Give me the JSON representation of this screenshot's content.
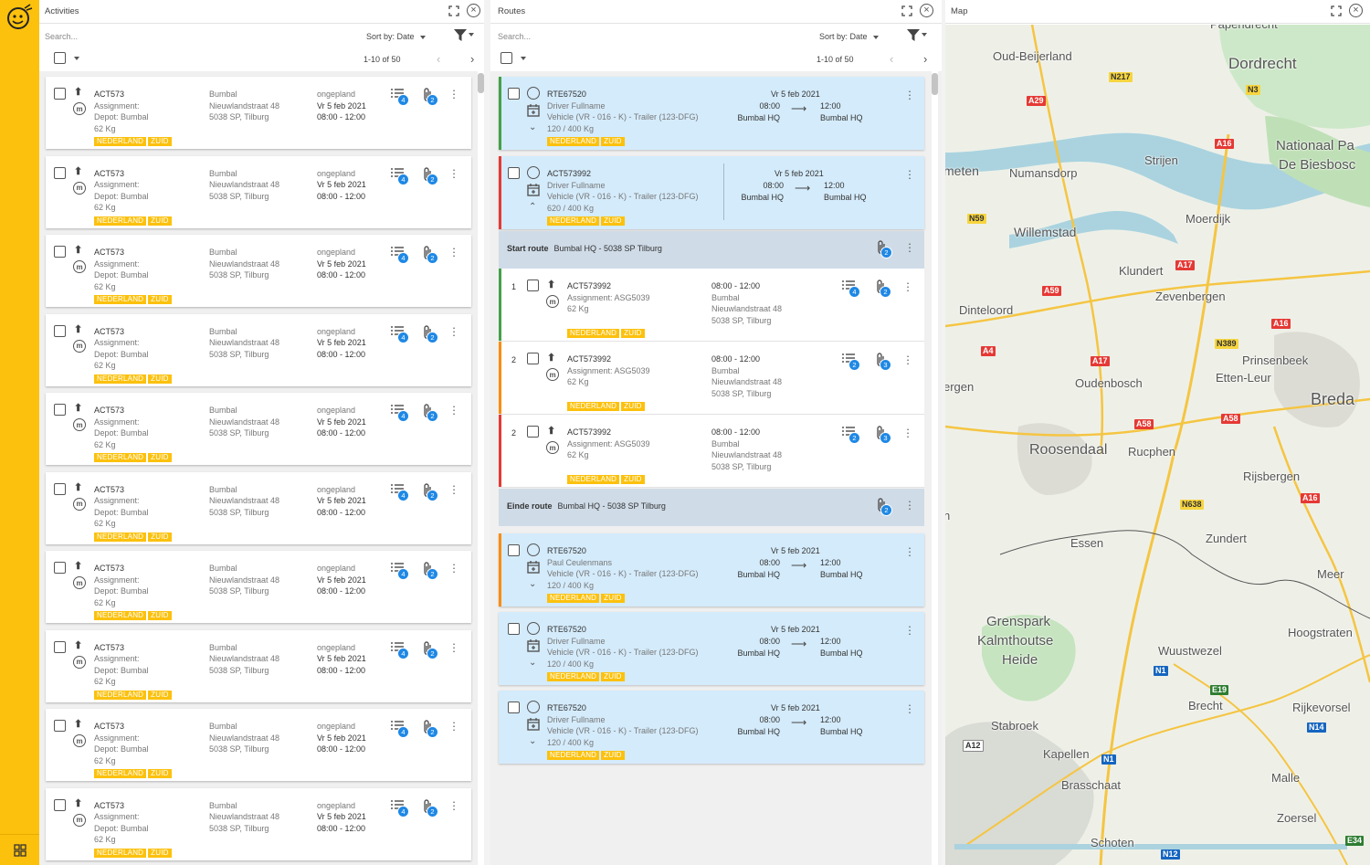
{
  "panels": {
    "activities": {
      "title": "Activities",
      "search_placeholder": "Search...",
      "sort_label": "Sort by: Date",
      "pager": "1-10 of 50"
    },
    "routes": {
      "title": "Routes",
      "search_placeholder": "Search...",
      "sort_label": "Sort by: Date",
      "pager": "1-10 of 50"
    },
    "map": {
      "title": "Map"
    }
  },
  "colors": {
    "brand": "#fcc10d",
    "badge": "#1e88e5",
    "route_bg": "#d4ebfb",
    "green": "#43a047",
    "red": "#e53935",
    "orange": "#fb8c00"
  },
  "activity_template": {
    "id": "ACT573",
    "assignment": "Assignment:",
    "depot": "Depot: Bumbal",
    "weight": "62 Kg",
    "addr_name": "Bumbal",
    "addr_street": "Nieuwlandstraat 48",
    "addr_city": "5038 SP, Tilburg",
    "status": "ongepland",
    "date": "Vr 5 feb 2021",
    "time": "08:00 - 12:00",
    "tags": [
      "NEDERLAND",
      "ZUID"
    ],
    "list_count": "4",
    "clip_count": "2"
  },
  "activity_count": 10,
  "routes": [
    {
      "id": "RTE67520",
      "driver": "Driver Fullname",
      "vehicle": "Vehicle (VR - 016 - K) - Trailer (123-DFG)",
      "load": "120 / 400 Kg",
      "date": "Vr 5 feb 2021",
      "start_time": "08:00",
      "start_place": "Bumbal HQ",
      "end_time": "12:00",
      "end_place": "Bumbal HQ",
      "tags": [
        "NEDERLAND",
        "ZUID"
      ],
      "bar": "#43a047"
    },
    {
      "id": "ACT573992",
      "driver": "Driver Fullname",
      "vehicle": "Vehicle (VR - 016 - K) - Trailer (123-DFG)",
      "load": "620 / 400 Kg",
      "date": "Vr 5 feb 2021",
      "start_time": "08:00",
      "start_place": "Bumbal HQ",
      "end_time": "12:00",
      "end_place": "Bumbal HQ",
      "tags": [
        "NEDERLAND",
        "ZUID"
      ],
      "bar": "#e53935"
    },
    {
      "id": "RTE67520",
      "driver": "Paul Ceulenmans",
      "vehicle": "Vehicle (VR - 016 - K) - Trailer (123-DFG)",
      "load": "120 / 400 Kg",
      "date": "Vr 5 feb 2021",
      "start_time": "08:00",
      "start_place": "Bumbal HQ",
      "end_time": "12:00",
      "end_place": "Bumbal HQ",
      "tags": [
        "NEDERLAND",
        "ZUID"
      ],
      "bar": "#fb8c00"
    },
    {
      "id": "RTE67520",
      "driver": "Driver Fullname",
      "vehicle": "Vehicle (VR - 016 - K) - Trailer (123-DFG)",
      "load": "120 / 400 Kg",
      "date": "Vr 5 feb 2021",
      "start_time": "08:00",
      "start_place": "Bumbal HQ",
      "end_time": "12:00",
      "end_place": "Bumbal HQ",
      "tags": [
        "NEDERLAND",
        "ZUID"
      ],
      "bar": ""
    },
    {
      "id": "RTE67520",
      "driver": "Driver Fullname",
      "vehicle": "Vehicle (VR - 016 - K) - Trailer (123-DFG)",
      "load": "120 / 400 Kg",
      "date": "Vr 5 feb 2021",
      "start_time": "08:00",
      "start_place": "Bumbal HQ",
      "end_time": "12:00",
      "end_place": "Bumbal HQ",
      "tags": [
        "NEDERLAND",
        "ZUID"
      ],
      "bar": ""
    }
  ],
  "start_route": {
    "label": "Start route",
    "value": "Bumbal HQ - 5038 SP Tilburg",
    "clip_count": "2"
  },
  "end_route": {
    "label": "Einde route",
    "value": "Bumbal HQ - 5038 SP Tilburg",
    "clip_count": "2"
  },
  "stops": [
    {
      "seq": "1",
      "id": "ACT573992",
      "assignment": "Assignment: ASG5039",
      "weight": "62 Kg",
      "time": "08:00 - 12:00",
      "name": "Bumbal",
      "street": "Nieuwlandstraat 48",
      "city": "5038 SP, Tilburg",
      "tags": [
        "NEDERLAND",
        "ZUID"
      ],
      "list_count": "4",
      "clip_count": "2",
      "bar": "#43a047"
    },
    {
      "seq": "2",
      "id": "ACT573992",
      "assignment": "Assignment: ASG5039",
      "weight": "62 Kg",
      "time": "08:00 - 12:00",
      "name": "Bumbal",
      "street": "Nieuwlandstraat 48",
      "city": "5038 SP, Tilburg",
      "tags": [
        "NEDERLAND",
        "ZUID"
      ],
      "list_count": "2",
      "clip_count": "3",
      "bar": "#fb8c00"
    },
    {
      "seq": "2",
      "id": "ACT573992",
      "assignment": "Assignment: ASG5039",
      "weight": "62 Kg",
      "time": "08:00 - 12:00",
      "name": "Bumbal",
      "street": "Nieuwlandstraat 48",
      "city": "5038 SP, Tilburg",
      "tags": [
        "NEDERLAND",
        "ZUID"
      ],
      "list_count": "2",
      "clip_count": "3",
      "bar": "#e53935"
    }
  ],
  "map": {
    "places": [
      "Papendrecht",
      "Oud-Beijerland",
      "Dordrecht",
      "Nationaal Pa",
      "De Biesbosc",
      "meten",
      "Numansdorp",
      "Strijen",
      "Moerdijk",
      "Willemstad",
      "Klundert",
      "Zevenbergen",
      "Dinteloord",
      "Prinsenbeek",
      "Etten-Leur",
      "Breda",
      "ergen",
      "Oudenbosch",
      "Roosendaal",
      "Rucphen",
      "Rijsbergen",
      "Essen",
      "Zundert",
      "Meer",
      "Grenspark",
      "Kalmthoutse",
      "Heide",
      "Hoogstraten",
      "Wuustwezel",
      "Brecht",
      "Rijkevorsel",
      "Stabroek",
      "Kapellen",
      "Brasschaat",
      "Malle",
      "Zoersel",
      "Schoten",
      "n"
    ],
    "roads": [
      "N217",
      "N3",
      "A29",
      "A16",
      "N59",
      "A17",
      "A59",
      "A16",
      "N389",
      "A4",
      "A17",
      "A58",
      "A58",
      "N638",
      "A16",
      "N1",
      "E19",
      "N14",
      "A12",
      "N1",
      "N12",
      "E34"
    ]
  }
}
